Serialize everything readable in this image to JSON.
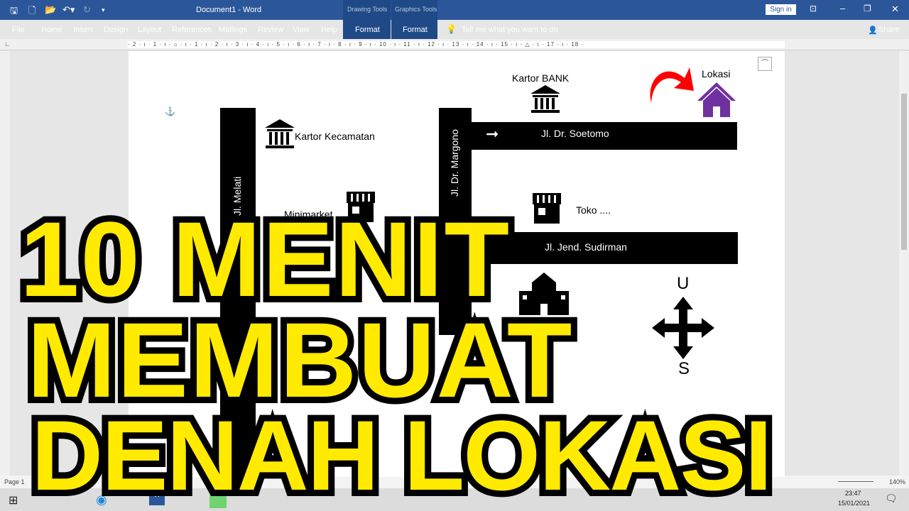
{
  "window": {
    "title": "Document1 - Word",
    "context_groups": [
      "Drawing Tools",
      "Graphics Tools"
    ],
    "sign_in": "Sign in",
    "share": "Share"
  },
  "ribbon": {
    "tabs": [
      "File",
      "Home",
      "Insert",
      "Design",
      "Layout",
      "References",
      "Mailings",
      "Review",
      "View",
      "Help",
      "Format",
      "Format"
    ],
    "tell_me": "Tell me what you want to do"
  },
  "ruler": {
    "text": "· 2 · ı · 1 · ı · ⌂ · ı · 1 · ı · 2 · ı · 3 · ı · 4 · ı · 5 · ı · 6 · ı · 7 · ı · 8 · ı · 9 · ı · 10 · ı · 11 · ı · 12 · ı · 13 · ı · 14 · ı · 15 · ı · △ · ı · 17 · ı · 18 ·"
  },
  "map": {
    "kantor_bank": "Kartor BANK",
    "lokasi": "Lokasi",
    "kantor_kecamatan": "Kartor Kecamatan",
    "minimarket": "Minimarket",
    "toko": "Toko ....",
    "roads": {
      "melati": "Jl. Melati",
      "margono": "Jl. Dr. Margono",
      "soetomo": "Jl. Dr. Soetomo",
      "sudirman": "Jl. Jend. Sudirman"
    },
    "compass": {
      "north": "U",
      "south": "S"
    },
    "colors": {
      "house": "#7030a0",
      "arrow": "#ff0000"
    }
  },
  "overlay": {
    "line1": "10 MENIT",
    "line2": "MEMBUAT",
    "line3": "DENAH LOKASI",
    "color": "#ffea00"
  },
  "status": {
    "page": "Page 1",
    "zoom": "140%"
  },
  "taskbar": {
    "time": "23:47",
    "date": "15/01/2021"
  }
}
